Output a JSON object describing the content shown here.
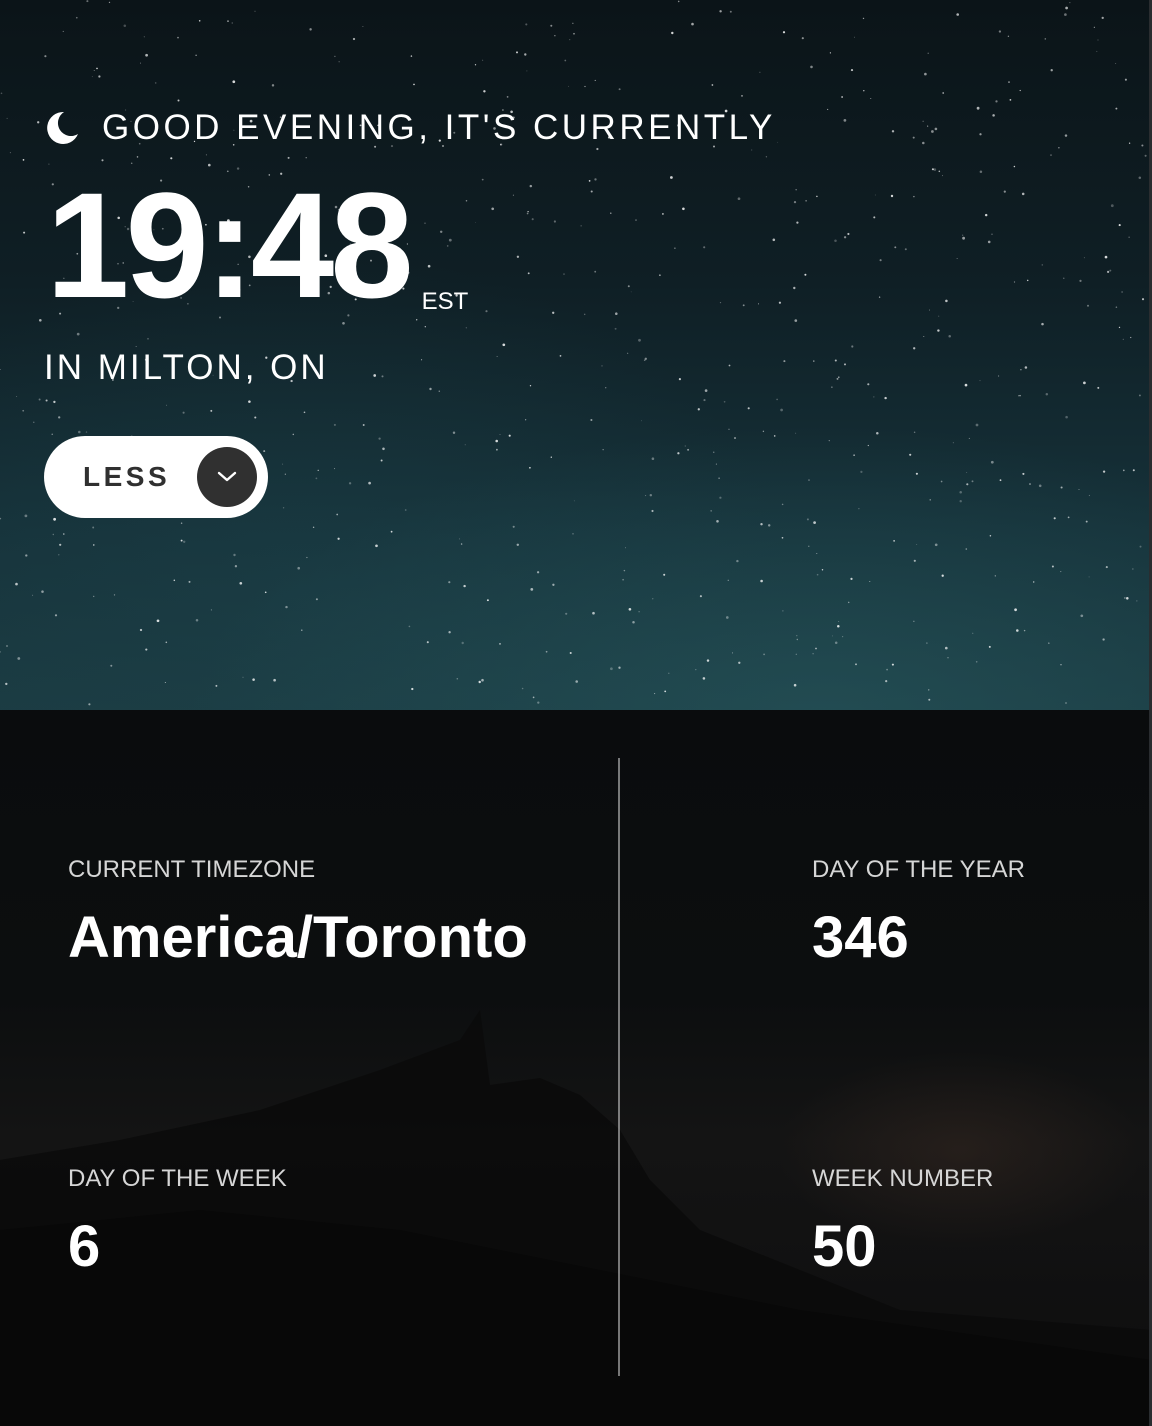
{
  "greeting": {
    "icon": "moon-icon",
    "text": "GOOD EVENING, IT'S CURRENTLY"
  },
  "clock": {
    "time": "19:48",
    "abbreviation": "EST"
  },
  "location": "IN MILTON, ON",
  "toggle": {
    "label": "LESS",
    "icon": "chevron-down-icon"
  },
  "details": {
    "timezone": {
      "label": "CURRENT TIMEZONE",
      "value": "America/Toronto"
    },
    "day_of_year": {
      "label": "DAY OF THE YEAR",
      "value": "346"
    },
    "day_of_week": {
      "label": "DAY OF THE WEEK",
      "value": "6"
    },
    "week_number": {
      "label": "WEEK NUMBER",
      "value": "50"
    }
  },
  "colors": {
    "toggle_background": "#ffffff",
    "toggle_circle": "#303030",
    "text": "#ffffff",
    "label_text": "#d6d6d6"
  }
}
